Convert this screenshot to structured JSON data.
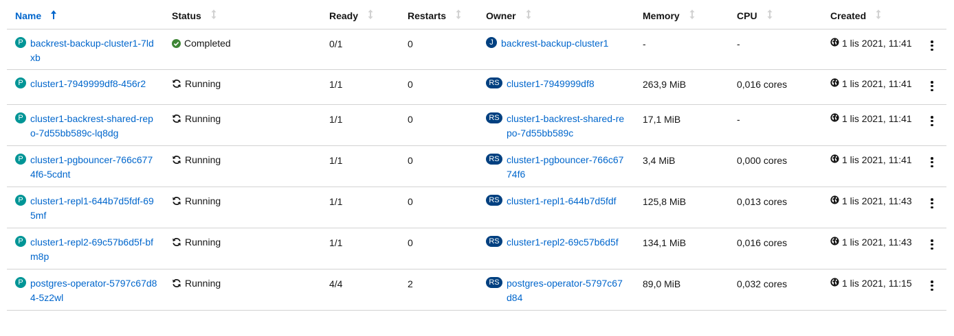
{
  "columns": {
    "name": "Name",
    "status": "Status",
    "ready": "Ready",
    "restarts": "Restarts",
    "owner": "Owner",
    "memory": "Memory",
    "cpu": "CPU",
    "created": "Created"
  },
  "sort": {
    "column": "Name",
    "direction": "ascending"
  },
  "colors": {
    "link": "#0066cc",
    "pod_badge": "#009596",
    "owner_badge": "#004080",
    "success": "#3e8635"
  },
  "rows": [
    {
      "name": "backrest-backup-cluster1-7ldxb",
      "name_badge": "P",
      "status": "Completed",
      "status_icon": "check-circle-icon",
      "ready": "0/1",
      "restarts": "0",
      "owner_badge": "J",
      "owner": "backrest-backup-cluster1",
      "memory": "-",
      "cpu": "-",
      "created": "1 lis 2021, 11:41"
    },
    {
      "name": "cluster1-7949999df8-456r2",
      "name_badge": "P",
      "status": "Running",
      "status_icon": "sync-icon",
      "ready": "1/1",
      "restarts": "0",
      "owner_badge": "RS",
      "owner": "cluster1-7949999df8",
      "memory": "263,9 MiB",
      "cpu": "0,016 cores",
      "created": "1 lis 2021, 11:41"
    },
    {
      "name": "cluster1-backrest-shared-repo-7d55bb589c-lq8dg",
      "name_badge": "P",
      "status": "Running",
      "status_icon": "sync-icon",
      "ready": "1/1",
      "restarts": "0",
      "owner_badge": "RS",
      "owner": "cluster1-backrest-shared-repo-7d55bb589c",
      "memory": "17,1 MiB",
      "cpu": "-",
      "created": "1 lis 2021, 11:41"
    },
    {
      "name": "cluster1-pgbouncer-766c6774f6-5cdnt",
      "name_badge": "P",
      "status": "Running",
      "status_icon": "sync-icon",
      "ready": "1/1",
      "restarts": "0",
      "owner_badge": "RS",
      "owner": "cluster1-pgbouncer-766c6774f6",
      "memory": "3,4 MiB",
      "cpu": "0,000 cores",
      "created": "1 lis 2021, 11:41"
    },
    {
      "name": "cluster1-repl1-644b7d5fdf-695mf",
      "name_badge": "P",
      "status": "Running",
      "status_icon": "sync-icon",
      "ready": "1/1",
      "restarts": "0",
      "owner_badge": "RS",
      "owner": "cluster1-repl1-644b7d5fdf",
      "memory": "125,8 MiB",
      "cpu": "0,013 cores",
      "created": "1 lis 2021, 11:43"
    },
    {
      "name": "cluster1-repl2-69c57b6d5f-bfm8p",
      "name_badge": "P",
      "status": "Running",
      "status_icon": "sync-icon",
      "ready": "1/1",
      "restarts": "0",
      "owner_badge": "RS",
      "owner": "cluster1-repl2-69c57b6d5f",
      "memory": "134,1 MiB",
      "cpu": "0,016 cores",
      "created": "1 lis 2021, 11:43"
    },
    {
      "name": "postgres-operator-5797c67d84-5z2wl",
      "name_badge": "P",
      "status": "Running",
      "status_icon": "sync-icon",
      "ready": "4/4",
      "restarts": "2",
      "owner_badge": "RS",
      "owner": "postgres-operator-5797c67d84",
      "memory": "89,0 MiB",
      "cpu": "0,032 cores",
      "created": "1 lis 2021, 11:15"
    }
  ]
}
